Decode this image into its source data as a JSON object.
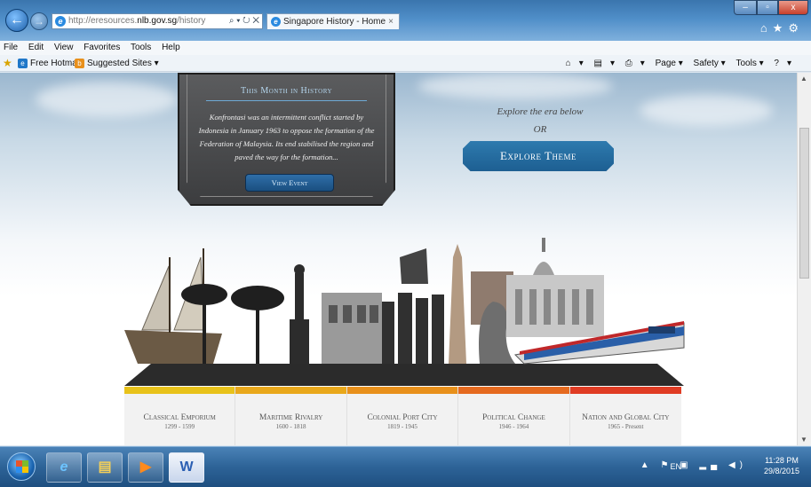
{
  "browser": {
    "url_prefix": "http://eresources.",
    "url_host": "nlb.gov.sg",
    "url_path": "/history",
    "address_tools": "⌕ ▾ ↻ ✕",
    "tab_title": "Singapore History - Home",
    "tab_close": "×",
    "window_controls": {
      "minimize": "–",
      "maximize": "▫",
      "close": "x"
    },
    "right_icons": "⌂★⚙"
  },
  "menubar": {
    "items": [
      "File",
      "Edit",
      "View",
      "Favorites",
      "Tools",
      "Help"
    ]
  },
  "favorites_bar": {
    "hotmail": "Free Hotmail",
    "suggested": "Suggested Sites ▾",
    "commands": [
      "▾",
      "▾",
      "▾",
      "Page ▾",
      "Safety ▾",
      "Tools ▾",
      "▾"
    ]
  },
  "month_card": {
    "title": "This Month in History",
    "body": "Konfrontasi was an intermittent conflict started by Indonesia in January 1963 to oppose the formation of the Federation of Malaysia. Its end stabilised the region and paved the way for the formation...",
    "button": "View Event"
  },
  "explore": {
    "line1": "Explore the era below",
    "line2": "OR",
    "button": "Explore Theme"
  },
  "eras": [
    {
      "name": "Classical Emporium",
      "years": "1299 - 1599",
      "color": "#e8c21a"
    },
    {
      "name": "Maritime Rivalry",
      "years": "1600 - 1818",
      "color": "#e9a81b"
    },
    {
      "name": "Colonial Port City",
      "years": "1819 - 1945",
      "color": "#e8901b"
    },
    {
      "name": "Political Change",
      "years": "1946 - 1964",
      "color": "#e56a1f"
    },
    {
      "name": "Nation and Global City",
      "years": "1965 - Present",
      "color": "#e03c24"
    }
  ],
  "taskbar": {
    "language": "EN",
    "tray_icons": "▲ ⚑ ▣ ▂▄ ◀)",
    "time": "11:28 PM",
    "date": "29/8/2015",
    "apps": {
      "ie": "e",
      "folder": "▤",
      "media": "▶",
      "word": "W"
    }
  },
  "colors": {
    "accent_blue": "#1d5f92",
    "card_dark": "#3c3d3f"
  }
}
